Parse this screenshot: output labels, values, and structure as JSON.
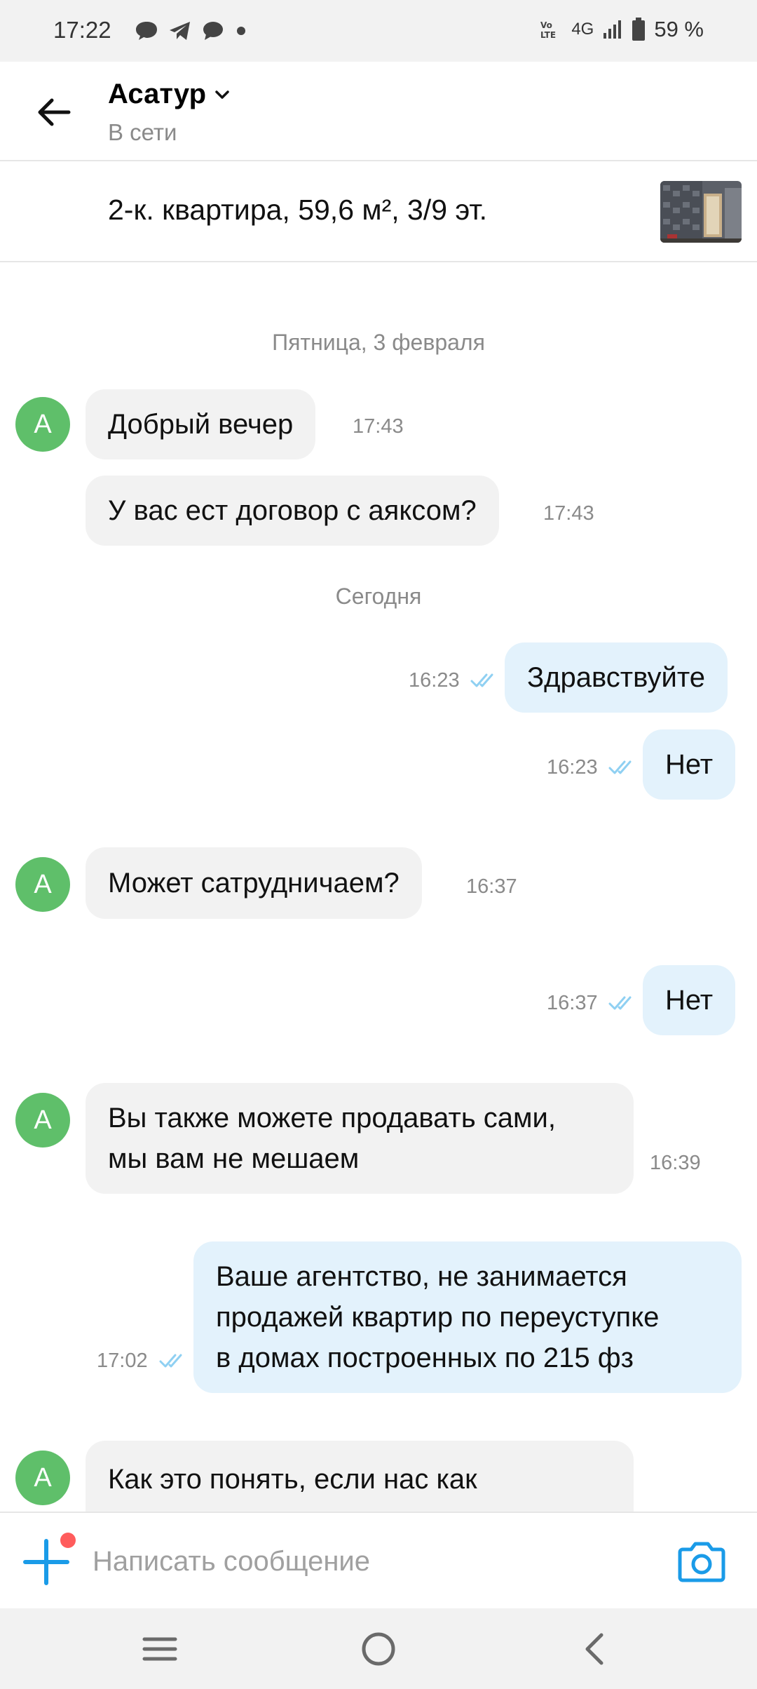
{
  "status_bar": {
    "time": "17:22",
    "network": "4G",
    "battery": "59 %",
    "icons": [
      "message-icon",
      "telegram-icon",
      "chat-icon",
      "dot-icon",
      "volte-icon",
      "signal-icon",
      "battery-icon"
    ]
  },
  "header": {
    "contact_name": "Асатур",
    "contact_status": "В сети"
  },
  "listing": {
    "title": "2-к. квартира, 59,6 м², 3/9 эт."
  },
  "dates": {
    "friday": "Пятница, 3 февраля",
    "today": "Сегодня"
  },
  "messages": [
    {
      "direction": "in",
      "avatar": "А",
      "text": "Добрый вечер",
      "time": "17:43"
    },
    {
      "direction": "in",
      "text": "У вас ест договор с аяксом?",
      "time": "17:43"
    },
    {
      "direction": "out",
      "text": "Здравствуйте",
      "time": "16:23"
    },
    {
      "direction": "out",
      "text": "Нет",
      "time": "16:23"
    },
    {
      "direction": "in",
      "avatar": "А",
      "text": "Может сатрудничаем?",
      "time": "16:37"
    },
    {
      "direction": "out",
      "text": "Нет",
      "time": "16:37"
    },
    {
      "direction": "in",
      "avatar": "А",
      "lines": [
        "Вы также можете продавать сами,",
        "мы вам не мешаем"
      ],
      "time": "16:39"
    },
    {
      "direction": "out",
      "lines": [
        "Ваше агентство, не занимается",
        "продажей квартир по переуступке",
        "в домах построенных по 215 фз"
      ],
      "time": "17:02"
    },
    {
      "direction": "in",
      "avatar": "А",
      "text": "Как это понять, если нас как"
    }
  ],
  "composer": {
    "placeholder": "Написать сообщение"
  },
  "colors": {
    "accent": "#1a9be8",
    "avatar": "#5fbf6a",
    "incoming_bubble": "#f2f2f2",
    "outgoing_bubble": "#e3f2fc",
    "read_checks": "#8fd0f2"
  }
}
